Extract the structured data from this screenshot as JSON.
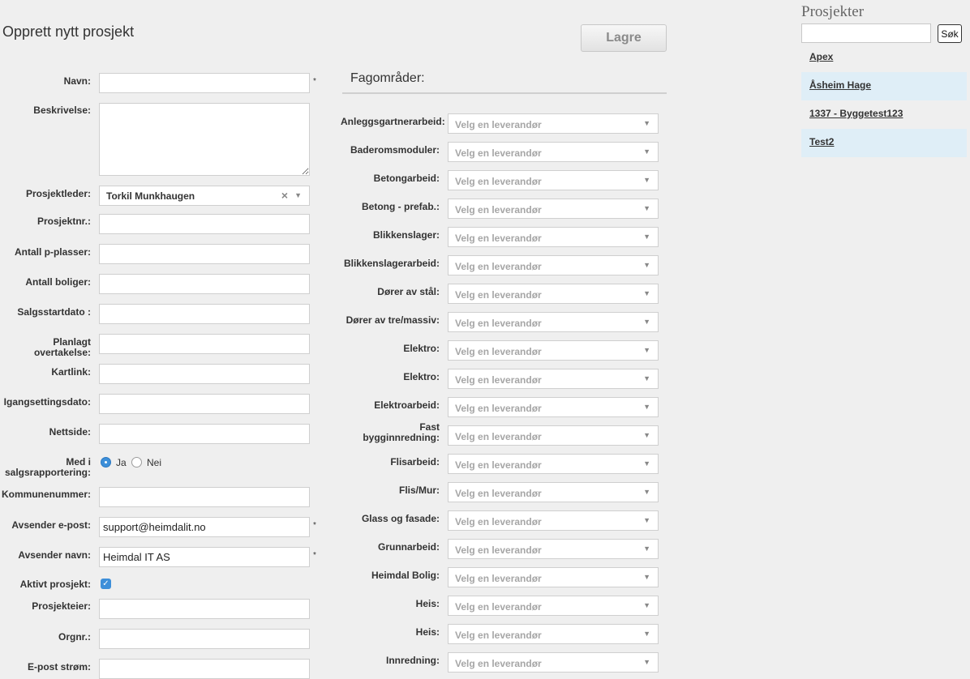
{
  "header": {
    "title": "Opprett nytt prosjekt",
    "save_label": "Lagre"
  },
  "required_marker": "*",
  "form": {
    "navn": {
      "label": "Navn:",
      "value": ""
    },
    "beskrivelse": {
      "label": "Beskrivelse:",
      "value": ""
    },
    "prosjektleder": {
      "label": "Prosjektleder:",
      "value": "Torkil Munkhaugen",
      "clear": "×",
      "arrow": "▼"
    },
    "prosjektnr": {
      "label": "Prosjektnr.:",
      "value": ""
    },
    "antall_pplasser": {
      "label": "Antall p-plasser:",
      "value": ""
    },
    "antall_boliger": {
      "label": "Antall boliger:",
      "value": ""
    },
    "salgsstartdato": {
      "label": "Salgsstartdato :",
      "value": ""
    },
    "planlagt_overtakelse": {
      "label_line1": "Planlagt",
      "label_line2": "overtakelse:",
      "value": ""
    },
    "kartlink": {
      "label": "Kartlink:",
      "value": ""
    },
    "igangsettingsdato": {
      "label": "Igangsettingsdato:",
      "value": ""
    },
    "nettside": {
      "label": "Nettside:",
      "value": ""
    },
    "med_i_salgsrapportering": {
      "label_line1": "Med i",
      "label_line2": "salgsrapportering:",
      "option_yes": "Ja",
      "option_no": "Nei",
      "selected": "Ja"
    },
    "kommunenummer": {
      "label": "Kommunenummer:",
      "value": ""
    },
    "avsender_epost": {
      "label": "Avsender e-post:",
      "value": "support@heimdalit.no"
    },
    "avsender_navn": {
      "label": "Avsender navn:",
      "value": "Heimdal IT AS"
    },
    "aktivt_prosjekt": {
      "label": "Aktivt prosjekt:",
      "checked": true,
      "check_glyph": "✓"
    },
    "prosjekteier": {
      "label": "Prosjekteier:",
      "value": ""
    },
    "orgnr": {
      "label": "Orgnr.:",
      "value": ""
    },
    "epost_strom": {
      "label": "E-post strøm:",
      "value": ""
    }
  },
  "fagomrader": {
    "title": "Fagområder:",
    "placeholder": "Velg en leverandør",
    "arrow": "▼",
    "items": [
      {
        "label": "Anleggsgartnerarbeid:"
      },
      {
        "label": "Baderomsmoduler:"
      },
      {
        "label": "Betongarbeid:"
      },
      {
        "label": "Betong - prefab.:"
      },
      {
        "label": "Blikkenslager:"
      },
      {
        "label": "Blikkenslagerarbeid:"
      },
      {
        "label": "Dører av stål:"
      },
      {
        "label": "Dører av tre/massiv:"
      },
      {
        "label": "Elektro:"
      },
      {
        "label": "Elektro:"
      },
      {
        "label": "Elektroarbeid:"
      },
      {
        "label_line1": "Fast",
        "label_line2": "bygginnredning:"
      },
      {
        "label": "Flisarbeid:"
      },
      {
        "label": "Flis/Mur:"
      },
      {
        "label": "Glass og fasade:"
      },
      {
        "label": "Grunnarbeid:"
      },
      {
        "label": "Heimdal Bolig:"
      },
      {
        "label": "Heis:"
      },
      {
        "label": "Heis:"
      },
      {
        "label": "Innredning:"
      }
    ]
  },
  "sidebar": {
    "title": "Prosjekter",
    "search_value": "",
    "search_button": "Søk",
    "projects": [
      {
        "name": "Apex"
      },
      {
        "name": "Åsheim Hage"
      },
      {
        "name": "1337 - Byggetest123"
      },
      {
        "name": "Test2"
      }
    ]
  }
}
